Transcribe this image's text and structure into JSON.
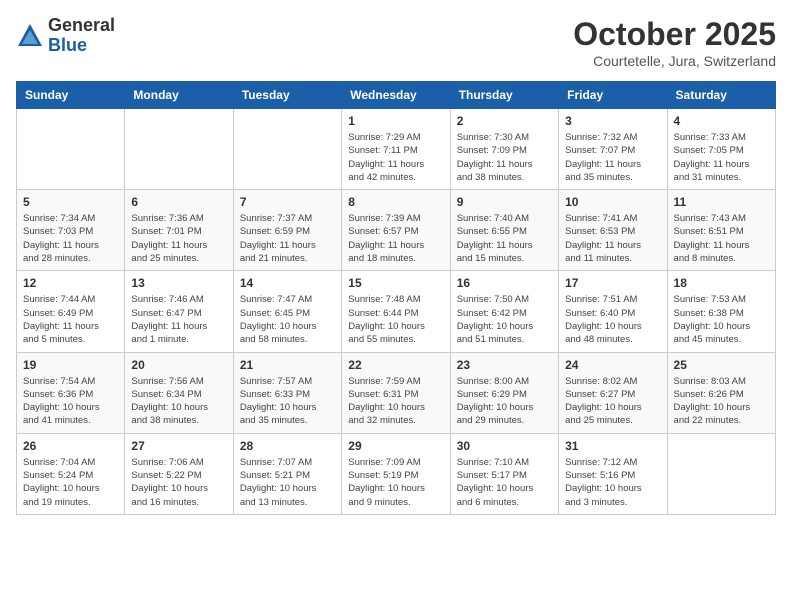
{
  "logo": {
    "general": "General",
    "blue": "Blue"
  },
  "header": {
    "month": "October 2025",
    "location": "Courtetelle, Jura, Switzerland"
  },
  "days_of_week": [
    "Sunday",
    "Monday",
    "Tuesday",
    "Wednesday",
    "Thursday",
    "Friday",
    "Saturday"
  ],
  "weeks": [
    [
      {
        "day": "",
        "info": ""
      },
      {
        "day": "",
        "info": ""
      },
      {
        "day": "",
        "info": ""
      },
      {
        "day": "1",
        "info": "Sunrise: 7:29 AM\nSunset: 7:11 PM\nDaylight: 11 hours\nand 42 minutes."
      },
      {
        "day": "2",
        "info": "Sunrise: 7:30 AM\nSunset: 7:09 PM\nDaylight: 11 hours\nand 38 minutes."
      },
      {
        "day": "3",
        "info": "Sunrise: 7:32 AM\nSunset: 7:07 PM\nDaylight: 11 hours\nand 35 minutes."
      },
      {
        "day": "4",
        "info": "Sunrise: 7:33 AM\nSunset: 7:05 PM\nDaylight: 11 hours\nand 31 minutes."
      }
    ],
    [
      {
        "day": "5",
        "info": "Sunrise: 7:34 AM\nSunset: 7:03 PM\nDaylight: 11 hours\nand 28 minutes."
      },
      {
        "day": "6",
        "info": "Sunrise: 7:36 AM\nSunset: 7:01 PM\nDaylight: 11 hours\nand 25 minutes."
      },
      {
        "day": "7",
        "info": "Sunrise: 7:37 AM\nSunset: 6:59 PM\nDaylight: 11 hours\nand 21 minutes."
      },
      {
        "day": "8",
        "info": "Sunrise: 7:39 AM\nSunset: 6:57 PM\nDaylight: 11 hours\nand 18 minutes."
      },
      {
        "day": "9",
        "info": "Sunrise: 7:40 AM\nSunset: 6:55 PM\nDaylight: 11 hours\nand 15 minutes."
      },
      {
        "day": "10",
        "info": "Sunrise: 7:41 AM\nSunset: 6:53 PM\nDaylight: 11 hours\nand 11 minutes."
      },
      {
        "day": "11",
        "info": "Sunrise: 7:43 AM\nSunset: 6:51 PM\nDaylight: 11 hours\nand 8 minutes."
      }
    ],
    [
      {
        "day": "12",
        "info": "Sunrise: 7:44 AM\nSunset: 6:49 PM\nDaylight: 11 hours\nand 5 minutes."
      },
      {
        "day": "13",
        "info": "Sunrise: 7:46 AM\nSunset: 6:47 PM\nDaylight: 11 hours\nand 1 minute."
      },
      {
        "day": "14",
        "info": "Sunrise: 7:47 AM\nSunset: 6:45 PM\nDaylight: 10 hours\nand 58 minutes."
      },
      {
        "day": "15",
        "info": "Sunrise: 7:48 AM\nSunset: 6:44 PM\nDaylight: 10 hours\nand 55 minutes."
      },
      {
        "day": "16",
        "info": "Sunrise: 7:50 AM\nSunset: 6:42 PM\nDaylight: 10 hours\nand 51 minutes."
      },
      {
        "day": "17",
        "info": "Sunrise: 7:51 AM\nSunset: 6:40 PM\nDaylight: 10 hours\nand 48 minutes."
      },
      {
        "day": "18",
        "info": "Sunrise: 7:53 AM\nSunset: 6:38 PM\nDaylight: 10 hours\nand 45 minutes."
      }
    ],
    [
      {
        "day": "19",
        "info": "Sunrise: 7:54 AM\nSunset: 6:36 PM\nDaylight: 10 hours\nand 41 minutes."
      },
      {
        "day": "20",
        "info": "Sunrise: 7:56 AM\nSunset: 6:34 PM\nDaylight: 10 hours\nand 38 minutes."
      },
      {
        "day": "21",
        "info": "Sunrise: 7:57 AM\nSunset: 6:33 PM\nDaylight: 10 hours\nand 35 minutes."
      },
      {
        "day": "22",
        "info": "Sunrise: 7:59 AM\nSunset: 6:31 PM\nDaylight: 10 hours\nand 32 minutes."
      },
      {
        "day": "23",
        "info": "Sunrise: 8:00 AM\nSunset: 6:29 PM\nDaylight: 10 hours\nand 29 minutes."
      },
      {
        "day": "24",
        "info": "Sunrise: 8:02 AM\nSunset: 6:27 PM\nDaylight: 10 hours\nand 25 minutes."
      },
      {
        "day": "25",
        "info": "Sunrise: 8:03 AM\nSunset: 6:26 PM\nDaylight: 10 hours\nand 22 minutes."
      }
    ],
    [
      {
        "day": "26",
        "info": "Sunrise: 7:04 AM\nSunset: 5:24 PM\nDaylight: 10 hours\nand 19 minutes."
      },
      {
        "day": "27",
        "info": "Sunrise: 7:06 AM\nSunset: 5:22 PM\nDaylight: 10 hours\nand 16 minutes."
      },
      {
        "day": "28",
        "info": "Sunrise: 7:07 AM\nSunset: 5:21 PM\nDaylight: 10 hours\nand 13 minutes."
      },
      {
        "day": "29",
        "info": "Sunrise: 7:09 AM\nSunset: 5:19 PM\nDaylight: 10 hours\nand 9 minutes."
      },
      {
        "day": "30",
        "info": "Sunrise: 7:10 AM\nSunset: 5:17 PM\nDaylight: 10 hours\nand 6 minutes."
      },
      {
        "day": "31",
        "info": "Sunrise: 7:12 AM\nSunset: 5:16 PM\nDaylight: 10 hours\nand 3 minutes."
      },
      {
        "day": "",
        "info": ""
      }
    ]
  ]
}
